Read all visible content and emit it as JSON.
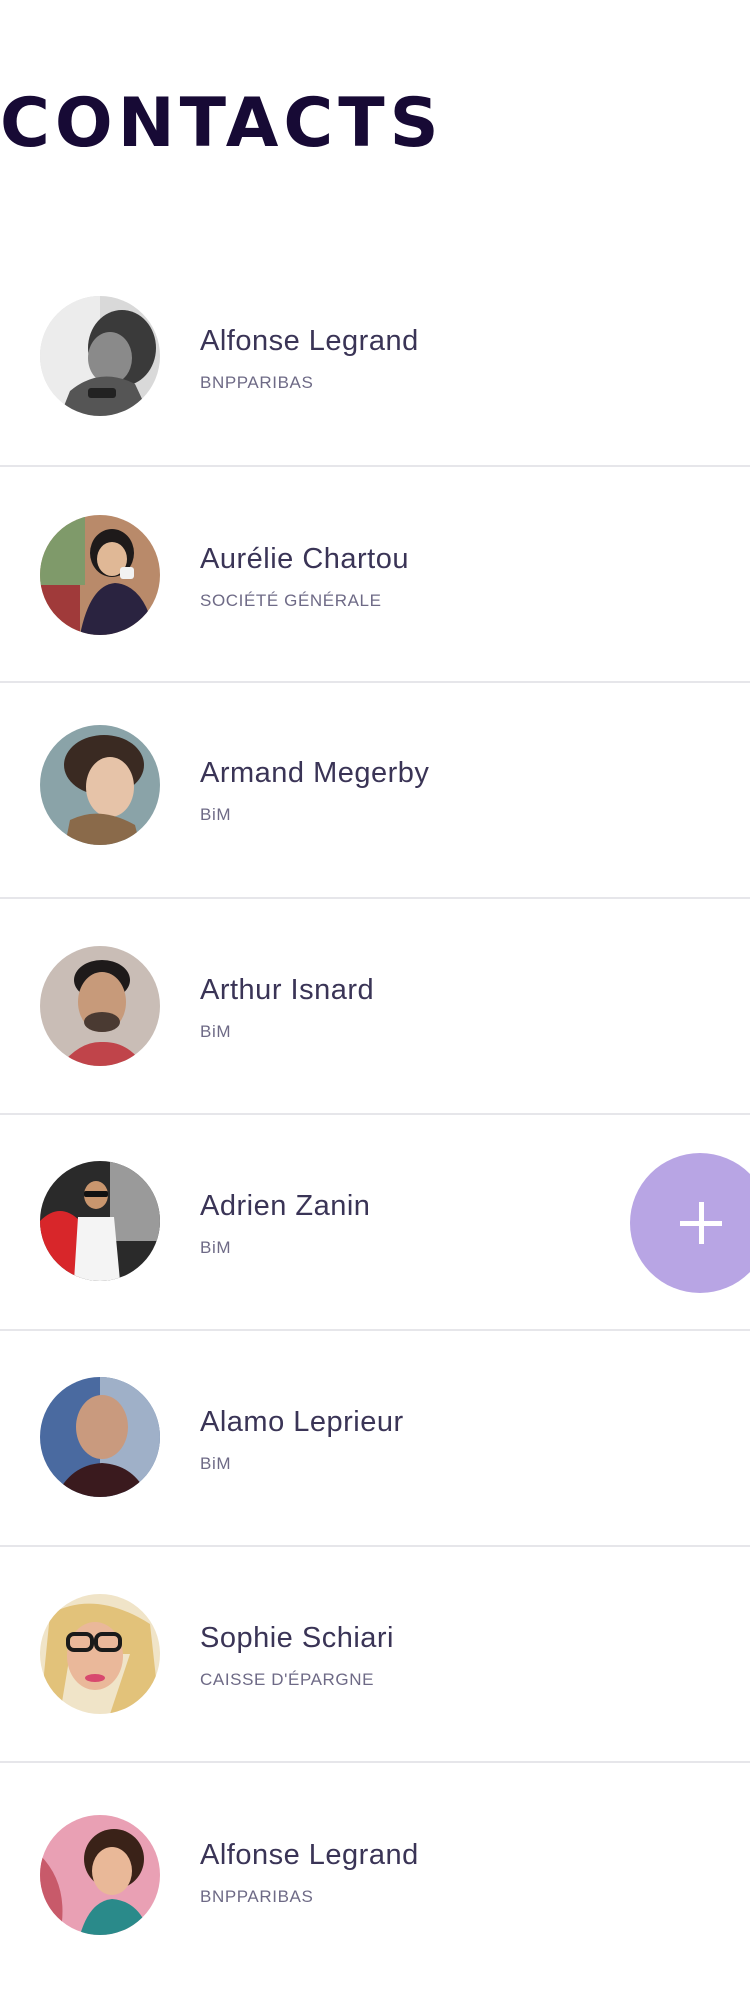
{
  "header": {
    "title": "CONTACTS"
  },
  "contacts": [
    {
      "name": "Alfonse Legrand",
      "company": "BNPPARIBAS",
      "avatar": "avatar-photo-man-bw"
    },
    {
      "name": "Aurélie Chartou",
      "company": "SOCIÉTÉ GÉNÉRALE",
      "avatar": "avatar-photo-woman-coffee"
    },
    {
      "name": "Armand Megerby",
      "company": "BiM",
      "avatar": "avatar-photo-young-man"
    },
    {
      "name": "Arthur Isnard",
      "company": "BiM",
      "avatar": "avatar-photo-bearded-man"
    },
    {
      "name": "Adrien Zanin",
      "company": "BiM",
      "avatar": "avatar-photo-man-sunglasses"
    },
    {
      "name": "Alamo Leprieur",
      "company": "BiM",
      "avatar": "avatar-photo-bald-man"
    },
    {
      "name": "Sophie Schiari",
      "company": "CAISSE D'ÉPARGNE",
      "avatar": "avatar-photo-blonde-woman"
    },
    {
      "name": "Alfonse Legrand",
      "company": "BNPPARIBAS",
      "avatar": "avatar-photo-woman-scarf"
    }
  ],
  "fab": {
    "icon": "plus-icon",
    "color": "#b8a5e4"
  },
  "colors": {
    "title": "#170a35",
    "name": "#3a3456",
    "company": "#6e6a86",
    "divider": "#e6e6ea"
  }
}
